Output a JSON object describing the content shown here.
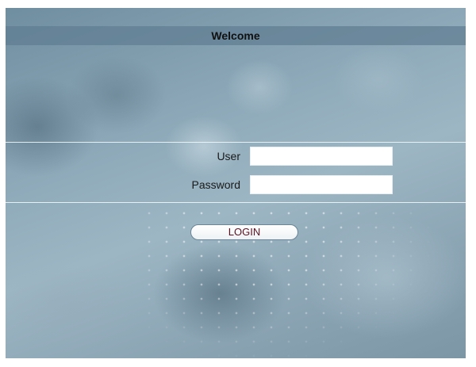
{
  "header": {
    "title": "Welcome"
  },
  "form": {
    "user_label": "User",
    "user_value": "",
    "password_label": "Password",
    "password_value": "",
    "login_label": "LOGIN"
  },
  "colors": {
    "header_bar": "#607d91",
    "login_text": "#5a1222",
    "background": "#8aa6b6"
  }
}
